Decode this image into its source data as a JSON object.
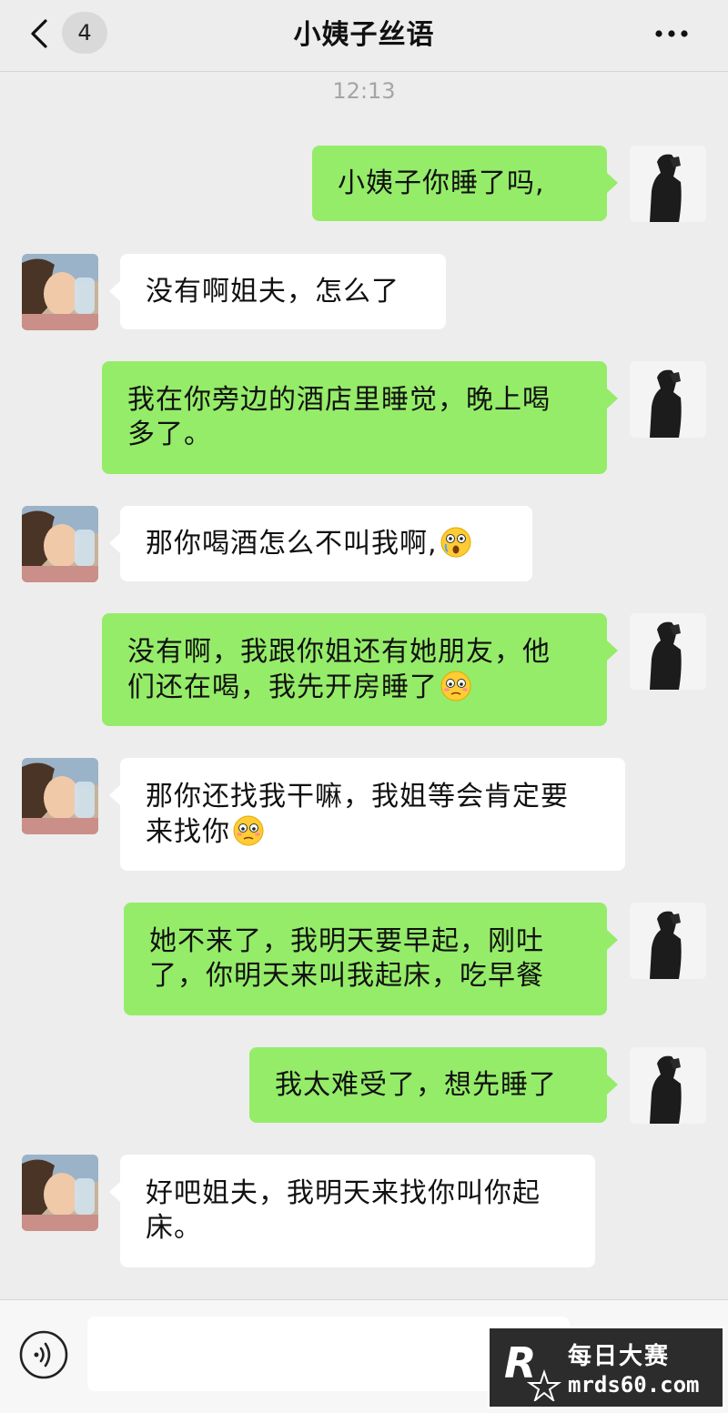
{
  "header": {
    "badge": "4",
    "title": "小姨子丝语"
  },
  "time": "12:13",
  "messages": [
    {
      "side": "right",
      "text": "小姨子你睡了吗,"
    },
    {
      "side": "left",
      "text": "没有啊姐夫，怎么了"
    },
    {
      "side": "right",
      "text": "我在你旁边的酒店里睡觉，晚上喝\n多了。"
    },
    {
      "side": "left",
      "text": "那你喝酒怎么不叫我啊,",
      "emoji": "shocked-emoji"
    },
    {
      "side": "right",
      "text": "没有啊，我跟你姐还有她朋友，他\n们还在喝，我先开房睡了",
      "emoji": "flushed-emoji"
    },
    {
      "side": "left",
      "text": "那你还找我干嘛，我姐等会肯定要\n来找你",
      "emoji": "flushed-emoji"
    },
    {
      "side": "right",
      "text": "她不来了，我明天要早起，刚吐\n了，你明天来叫我起床，吃早餐"
    },
    {
      "side": "right",
      "text": "我太难受了，想先睡了"
    },
    {
      "side": "left",
      "text": "好吧姐夫，我明天来找你叫你起\n床。"
    }
  ],
  "watermark": {
    "logo_letter": "R",
    "line1": "每日大赛",
    "line2": "mrds60.com"
  },
  "colors": {
    "background": "#ededed",
    "bubble_sent": "#95ec69",
    "bubble_received": "#ffffff"
  }
}
